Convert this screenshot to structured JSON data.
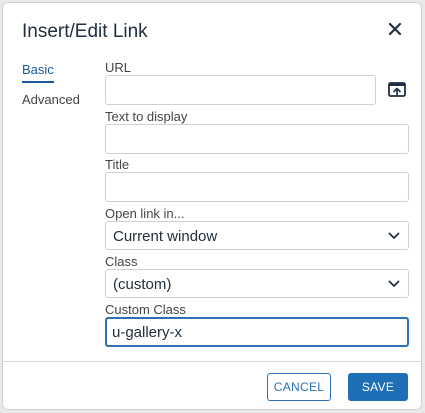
{
  "dialog": {
    "title": "Insert/Edit Link",
    "close_icon": "close-icon"
  },
  "tabs": [
    {
      "label": "Basic",
      "active": true
    },
    {
      "label": "Advanced",
      "active": false
    }
  ],
  "fields": {
    "url": {
      "label": "URL",
      "value": "",
      "browse_icon": "browse-icon"
    },
    "text_to_display": {
      "label": "Text to display",
      "value": ""
    },
    "title": {
      "label": "Title",
      "value": ""
    },
    "open_link_in": {
      "label": "Open link in...",
      "selected": "Current window"
    },
    "class": {
      "label": "Class",
      "selected": "(custom)"
    },
    "custom_class": {
      "label": "Custom Class",
      "value": "u-gallery-x"
    }
  },
  "footer": {
    "cancel_label": "CANCEL",
    "save_label": "SAVE"
  },
  "colors": {
    "accent": "#1e6fb6",
    "text": "#222f3e",
    "border": "#ccd1d6"
  }
}
